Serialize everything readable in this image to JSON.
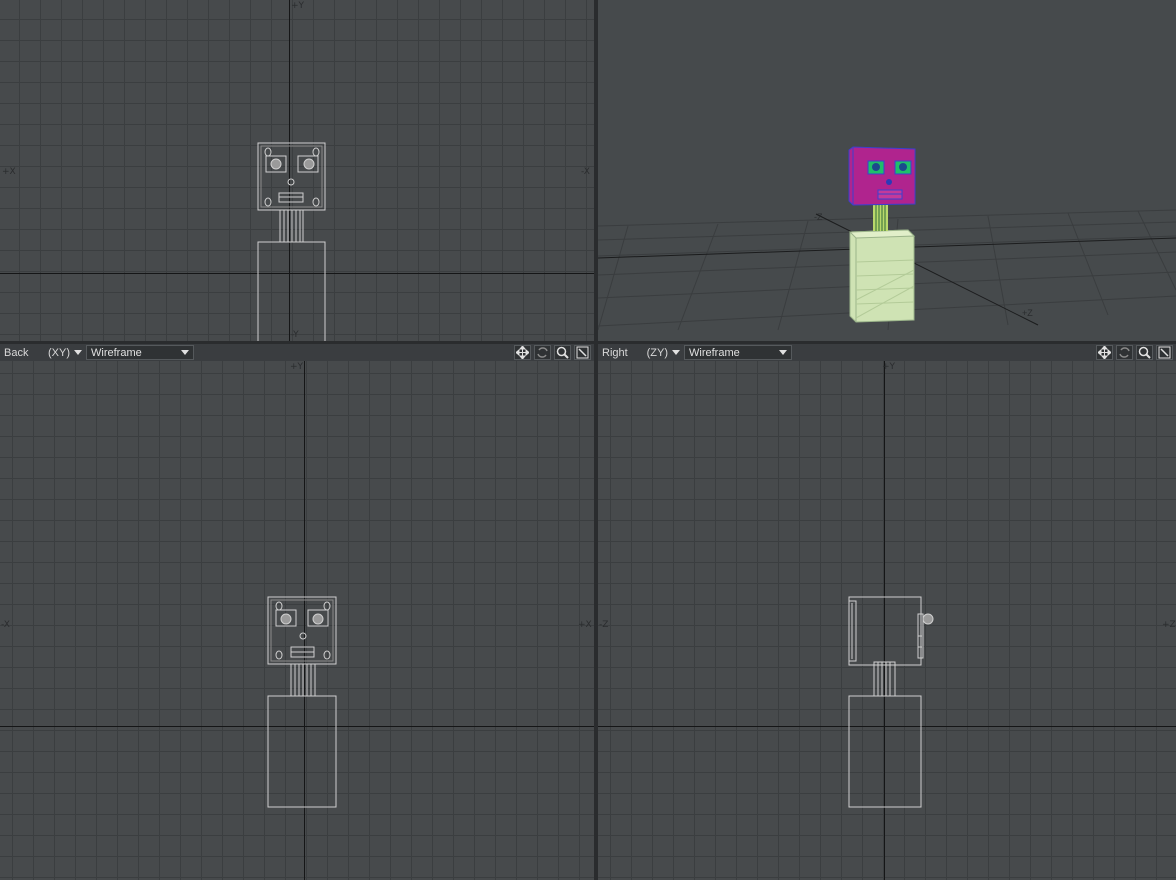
{
  "viewports": {
    "top_left": {
      "axis_labels": {
        "top": "+Y",
        "bottom": "-Y",
        "left": "+X",
        "right": "-X"
      }
    },
    "top_right": {
      "axis_labels": {
        "z_neg": "-Z",
        "z_pos": "+Z"
      }
    },
    "bottom_left": {
      "view_name": "Back",
      "axis_pair": "(XY)",
      "shading": "Wireframe",
      "axis_labels": {
        "top": "+Y",
        "left": "-X",
        "right": "+X"
      }
    },
    "bottom_right": {
      "view_name": "Right",
      "axis_pair": "(ZY)",
      "shading": "Wireframe",
      "axis_labels": {
        "top": "+Y",
        "left": "-Z",
        "right": "+Z"
      }
    }
  },
  "toolbar_icons": [
    "move-icon",
    "rotate-icon",
    "zoom-icon",
    "maximize-icon"
  ],
  "colors": {
    "viewport_bg": "#474a4c",
    "grid_line": "#3b3e40",
    "axis_line": "#151617",
    "wire": "#cfcfcf",
    "head": "#b0248e",
    "eyes": "#1fbf6a",
    "neck": "#b9d86b",
    "body": "#cfe3b4"
  }
}
